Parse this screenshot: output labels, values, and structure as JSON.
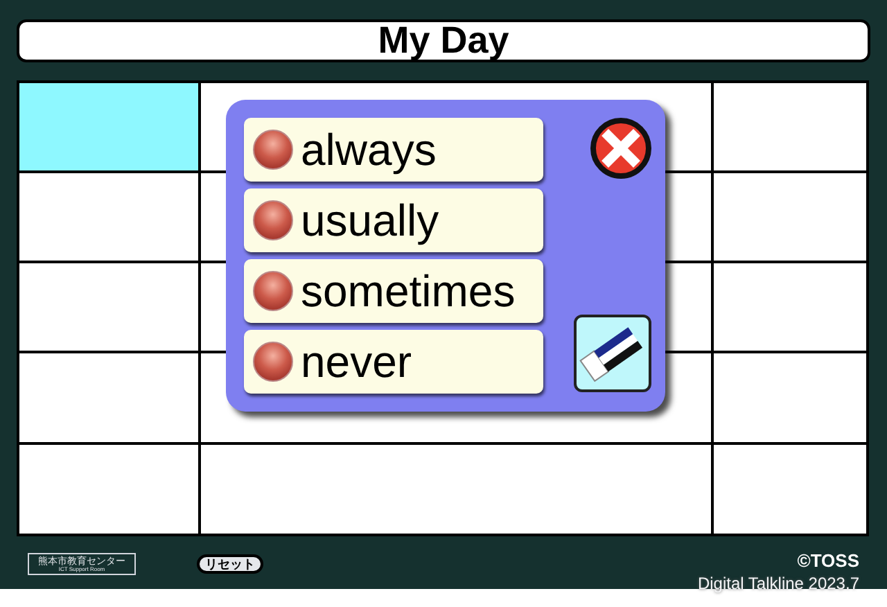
{
  "title": "My Day",
  "grid": {
    "rows": [
      {
        "cells": [
          {
            "highlighted": true
          },
          {
            "highlighted": false
          },
          {
            "highlighted": false
          }
        ]
      },
      {
        "cells": [
          {
            "highlighted": false
          },
          {
            "highlighted": false
          },
          {
            "highlighted": false
          }
        ]
      },
      {
        "cells": [
          {
            "highlighted": false
          },
          {
            "highlighted": false
          },
          {
            "highlighted": false
          }
        ]
      },
      {
        "cells": [
          {
            "highlighted": false
          },
          {
            "highlighted": false
          },
          {
            "highlighted": false
          }
        ]
      },
      {
        "cells": [
          {
            "highlighted": false
          },
          {
            "highlighted": false
          },
          {
            "highlighted": false
          }
        ]
      }
    ]
  },
  "popup": {
    "options": [
      {
        "label": "always"
      },
      {
        "label": "usually"
      },
      {
        "label": "sometimes"
      },
      {
        "label": "never"
      }
    ]
  },
  "footer": {
    "logo_line_1": "熊本市教育センター",
    "logo_line_2": "ICT Support Room",
    "reset_button": "リセット",
    "copyright": "©TOSS",
    "credit": "Digital Talkline 2023.7"
  }
}
